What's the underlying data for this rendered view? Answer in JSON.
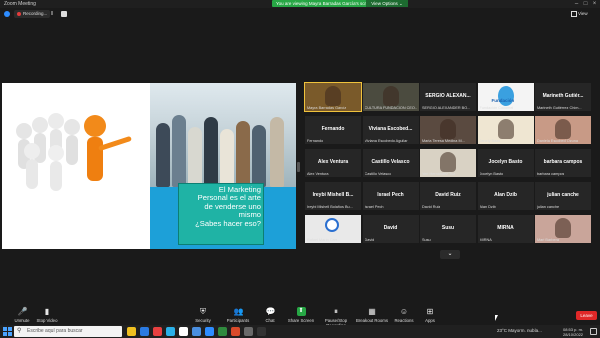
{
  "window": {
    "app_title": "Zoom Meeting",
    "share_banner": "You are viewing Mayra Barradas García's screen",
    "view_options": "View Options ⌄"
  },
  "recording": {
    "label": "Recording...",
    "view_label": "View"
  },
  "slide": {
    "lines": [
      "El Marketing",
      "Personal es el arte",
      "de venderse uno",
      "mismo",
      "¿Sabes hacer eso?"
    ],
    "colors": {
      "figure_orange": "#f28a1a",
      "figure_white": "#e8e8e8",
      "blue_panel": "#1da0d8",
      "teal_box": "#1fb3a5"
    }
  },
  "gallery": {
    "tiles": [
      {
        "name": "",
        "caption": "Mayra Barradas García",
        "video": true,
        "active": true,
        "bg": "#7a5a2a"
      },
      {
        "name": "",
        "caption": "CULTURA FUNDACION CEO...",
        "video": true,
        "bg": "#4b4b3f"
      },
      {
        "name": "SERGIO ALEXAN...",
        "caption": "SERGIO ALEXANDER BO...",
        "video": false
      },
      {
        "name": "",
        "caption": "Fundación Cocomel",
        "video": true,
        "bg": "#f4f4f4",
        "logo": "Fundación"
      },
      {
        "name": "Marineth Gutiér...",
        "caption": "Marineth Gutiérrez Chim...",
        "video": false
      },
      {
        "name": "Fernando",
        "caption": "Fernando",
        "video": false
      },
      {
        "name": "Viviana Escobed...",
        "caption": "Viviana Escobedo Aguilar",
        "video": false
      },
      {
        "name": "",
        "caption": "Maria Teresa Medina M...",
        "video": true,
        "bg": "#5a4a40"
      },
      {
        "name": "",
        "caption": "Janely Baas",
        "video": true,
        "bg": "#efe6d2"
      },
      {
        "name": "",
        "caption": "Daniela Escobed Ozuna",
        "video": true,
        "bg": "#c89a86"
      },
      {
        "name": "Alex Ventura",
        "caption": "Alex Ventura",
        "video": false
      },
      {
        "name": "Castillo Velasco",
        "caption": "Castillo Velasco",
        "video": false
      },
      {
        "name": "",
        "caption": "Yeri Hernández Tuz",
        "video": true,
        "bg": "#d9d2c4"
      },
      {
        "name": "Jocelyn Basto",
        "caption": "Jocelyn Basto",
        "video": false
      },
      {
        "name": "barbara campos",
        "caption": "barbara campos",
        "video": false
      },
      {
        "name": "Ireybi Mishell B...",
        "caption": "Ireybi Mishell Bolaños Bu...",
        "video": false
      },
      {
        "name": "Israel Pech",
        "caption": "Israel Pech",
        "video": false
      },
      {
        "name": "David Ruiz",
        "caption": "David Ruiz",
        "video": false
      },
      {
        "name": "Alan Dzib",
        "caption": "Alan Dzib",
        "video": false
      },
      {
        "name": "julian canche",
        "caption": "julian canche",
        "video": false
      },
      {
        "name": "",
        "caption": "Rafael Marín Carr...",
        "video": true,
        "bg": "#e9e9e9",
        "clock": true
      },
      {
        "name": "David",
        "caption": "David",
        "video": false
      },
      {
        "name": "Susu",
        "caption": "Susu",
        "video": false
      },
      {
        "name": "MIRNA",
        "caption": "MIRNA",
        "video": false
      },
      {
        "name": "",
        "caption": "Mari Barbera",
        "video": true,
        "bg": "#c9a59a"
      }
    ],
    "more_glyph": "⌄"
  },
  "toolbar": {
    "items": [
      {
        "id": "unmute",
        "label": "Unmute",
        "icon": "microphone-muted-icon",
        "glyph": "🎤"
      },
      {
        "id": "stop-video",
        "label": "Stop Video",
        "icon": "video-camera-icon",
        "glyph": "▮"
      },
      {
        "id": "security",
        "label": "Security",
        "icon": "shield-icon",
        "glyph": "⛨"
      },
      {
        "id": "participants",
        "label": "Participants",
        "icon": "participants-icon",
        "glyph": "👥"
      },
      {
        "id": "chat",
        "label": "Chat",
        "icon": "chat-icon",
        "glyph": "💬"
      },
      {
        "id": "share-screen",
        "label": "Share Screen",
        "icon": "share-screen-icon",
        "glyph": "⬆"
      },
      {
        "id": "pause-recording",
        "label": "Pause/Stop Recording",
        "icon": "recording-icon",
        "glyph": "⏸"
      },
      {
        "id": "breakout-rooms",
        "label": "Breakout Rooms",
        "icon": "breakout-rooms-icon",
        "glyph": "▦"
      },
      {
        "id": "reactions",
        "label": "Reactions",
        "icon": "reactions-icon",
        "glyph": "☺"
      },
      {
        "id": "apps",
        "label": "Apps",
        "icon": "apps-icon",
        "glyph": "⊞"
      }
    ],
    "end_label": "Leave"
  },
  "taskbar": {
    "search_placeholder": "Escribe aquí para buscar",
    "weather": "23°C  Mayorm. nubla...",
    "time": "08:53 p. m.",
    "date": "28/10/2022",
    "app_colors": [
      "#f0c020",
      "#2a7ae2",
      "#e84040",
      "#2ab0e8",
      "#ffffff",
      "#4a8fe0",
      "#2d8cff",
      "#2f8a3e",
      "#d84a2a",
      "#6a6a6a",
      "#333333"
    ]
  }
}
